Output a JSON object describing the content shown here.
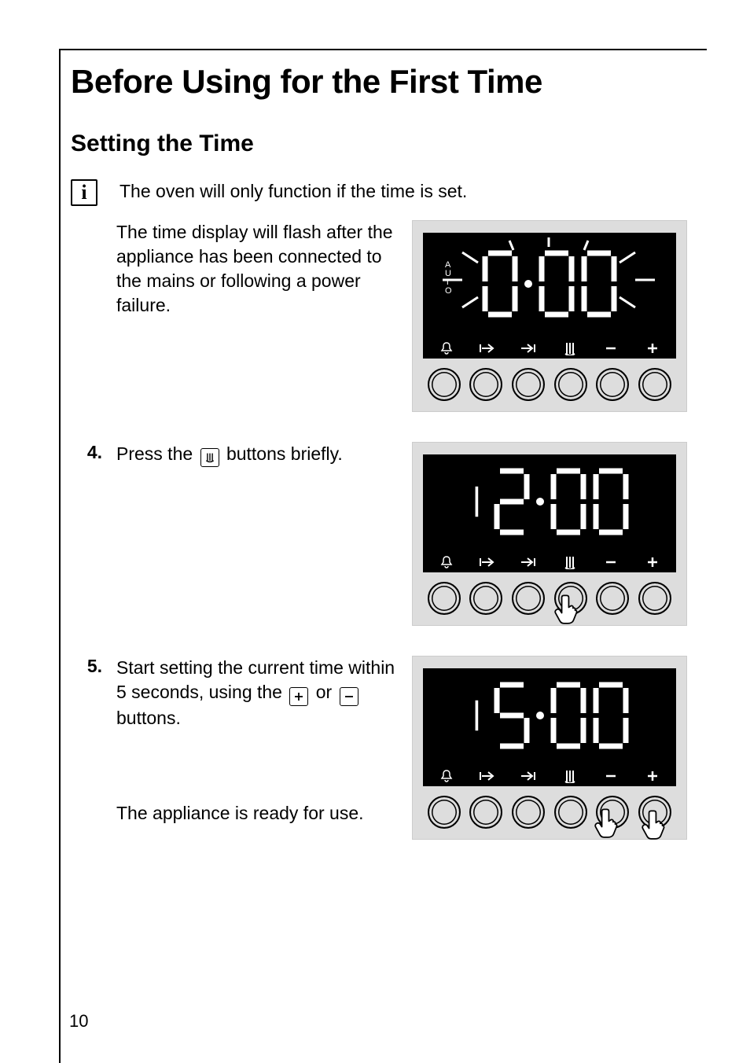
{
  "page_number": "10",
  "title": "Before Using for the First Time",
  "subtitle": "Setting the Time",
  "info_note": "The oven will only function if the time is set.",
  "para_flash": "The time display will flash after the appliance has been connected to the mains or following a power failure.",
  "steps": {
    "s4": {
      "num": "4.",
      "text_before": "Press the ",
      "text_after": " buttons briefly."
    },
    "s5": {
      "num": "5.",
      "text_a": "Start setting the current time within 5 seconds, using the ",
      "text_b": " or ",
      "text_c": " buttons."
    }
  },
  "ready": "The appliance is ready for use.",
  "displays": {
    "d1": "0:00",
    "d2": "12:00",
    "d3": "15:00"
  },
  "icons": {
    "bell": "bell-icon",
    "start": "start-time-icon",
    "end": "end-time-icon",
    "clock": "clock-icon",
    "minus": "minus-icon",
    "plus": "plus-icon"
  }
}
